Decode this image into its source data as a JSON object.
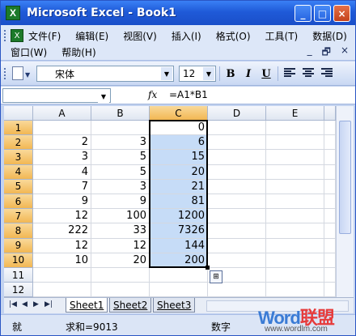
{
  "window": {
    "title": "Microsoft Excel - Book1",
    "app_icon": "excel-icon"
  },
  "window_controls": {
    "minimize": "_",
    "maximize": "□",
    "close": "×"
  },
  "menu": {
    "row1": [
      "文件(F)",
      "编辑(E)",
      "视图(V)",
      "插入(I)",
      "格式(O)",
      "工具(T)",
      "数据(D)"
    ],
    "row2": [
      "窗口(W)",
      "帮助(H)"
    ],
    "doc_controls": [
      "_",
      "🗗",
      "×"
    ]
  },
  "toolbar": {
    "font_name": "宋体",
    "font_size": "12",
    "bold": "B",
    "italic": "I",
    "underline": "U"
  },
  "formula_bar": {
    "name_box": "",
    "fx": "fx",
    "formula": "=A1*B1"
  },
  "grid": {
    "columns": [
      "A",
      "B",
      "C",
      "D",
      "E"
    ],
    "selected_column": "C",
    "rows": [
      {
        "n": "1",
        "A": "",
        "B": "",
        "C": "0"
      },
      {
        "n": "2",
        "A": "2",
        "B": "3",
        "C": "6"
      },
      {
        "n": "3",
        "A": "3",
        "B": "5",
        "C": "15"
      },
      {
        "n": "4",
        "A": "4",
        "B": "5",
        "C": "20"
      },
      {
        "n": "5",
        "A": "7",
        "B": "3",
        "C": "21"
      },
      {
        "n": "6",
        "A": "9",
        "B": "9",
        "C": "81"
      },
      {
        "n": "7",
        "A": "12",
        "B": "100",
        "C": "1200"
      },
      {
        "n": "8",
        "A": "222",
        "B": "33",
        "C": "7326"
      },
      {
        "n": "9",
        "A": "12",
        "B": "12",
        "C": "144"
      },
      {
        "n": "10",
        "A": "10",
        "B": "20",
        "C": "200"
      },
      {
        "n": "11",
        "A": "",
        "B": "",
        "C": ""
      },
      {
        "n": "12",
        "A": "",
        "B": "",
        "C": ""
      }
    ]
  },
  "sheets": [
    "Sheet1",
    "Sheet2",
    "Sheet3"
  ],
  "active_sheet": "Sheet1",
  "status": {
    "ready": "就",
    "sum": "求和=9013",
    "num": "数字"
  },
  "watermark": {
    "logo_a": "Word",
    "logo_b": "联盟",
    "url": "www.wordlm.com"
  }
}
